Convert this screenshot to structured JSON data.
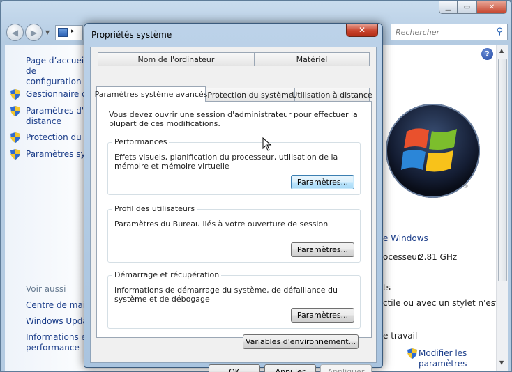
{
  "background_window": {
    "search_placeholder": "Rechercher",
    "left_pane": {
      "home_link": "Page d’accueil de\nconfiguration",
      "tasks": [
        "Gestionnaire de",
        "Paramètres d'uti\ndistance",
        "Protection du sy",
        "Paramètres syste"
      ],
      "see_also_heading": "Voir aussi",
      "see_also": [
        "Centre de maint",
        "Windows Updat",
        "Informations et\nperformance"
      ]
    },
    "right_pane": {
      "edition_link": "e Windows",
      "processor_label": "ocesseur",
      "processor_value": "2.81 GHz",
      "line_ts": "ts",
      "touch_text": "ctile ou avec un stylet n'est",
      "workgroup_text": "e travail",
      "change_settings_link": "Modifier les\nparamètres"
    }
  },
  "dialog": {
    "title": "Propriétés système",
    "close_label": "✕",
    "tabs_row1": [
      "Nom de l'ordinateur",
      "Matériel"
    ],
    "tabs_row2": [
      "Paramètres système avancés",
      "Protection du système",
      "Utilisation à distance"
    ],
    "active_tab": "Paramètres système avancés",
    "admin_note": "Vous devez ouvrir une session d'administrateur pour effectuer la plupart de ces modifications.",
    "groups": {
      "performance": {
        "title": "Performances",
        "desc": "Effets visuels, planification du processeur, utilisation de la mémoire et mémoire virtuelle",
        "button": "Paramètres..."
      },
      "profiles": {
        "title": "Profil des utilisateurs",
        "desc": "Paramètres du Bureau liés à votre ouverture de session",
        "button": "Paramètres..."
      },
      "startup": {
        "title": "Démarrage et récupération",
        "desc": "Informations de démarrage du système, de défaillance du système et de débogage",
        "button": "Paramètres..."
      }
    },
    "env_button": "Variables d'environnement...",
    "ok": "OK",
    "cancel": "Annuler",
    "apply": "Appliquer"
  }
}
